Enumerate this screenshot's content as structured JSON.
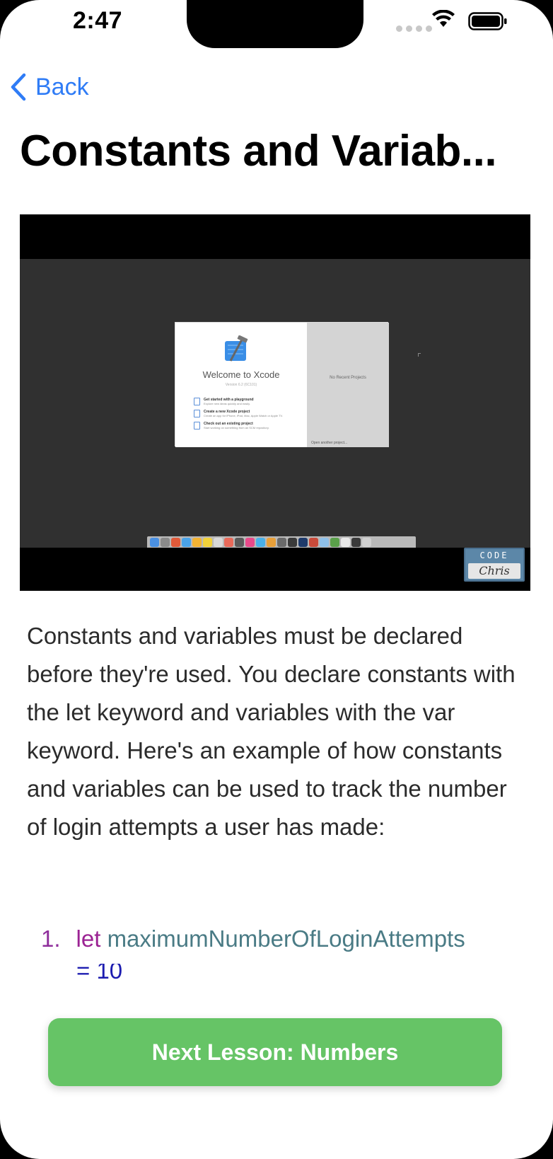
{
  "status_bar": {
    "time": "2:47"
  },
  "nav": {
    "back_label": "Back"
  },
  "lesson": {
    "title": "Constants and Variab...",
    "description": "Constants and variables must be declared before they're used. You declare constants with the let keyword and variables with the var keyword. Here's an example of how constants and variables can be used to track the number of login attempts a user has made:",
    "code": {
      "line_number": "1.",
      "keyword": "let",
      "identifier": "maximumNumberOfLoginAttempts",
      "continuation": "= 10"
    }
  },
  "video": {
    "xcode_welcome": "Welcome to Xcode",
    "xcode_version": "Version 6.2 (6C101)",
    "xcode_options": [
      {
        "title": "Get started with a playground",
        "subtitle": "Explore new ideas quickly and easily."
      },
      {
        "title": "Create a new Xcode project",
        "subtitle": "Create an app for iPhone, iPad, Mac, Apple Watch or Apple TV."
      },
      {
        "title": "Check out an existing project",
        "subtitle": "Start working on something from an SCM repository."
      }
    ],
    "xcode_no_recent": "No Recent Projects",
    "xcode_open_another": "Open another project...",
    "watermark_top": "CODE",
    "watermark_bottom": "Chris"
  },
  "next_button": {
    "label": "Next Lesson: Numbers"
  },
  "colors": {
    "accent": "#2f7cf6",
    "button_green": "#66c466",
    "code_keyword": "#9b2393",
    "code_identifier": "#4a7b85"
  },
  "icons": [
    "chevron-left-icon",
    "wifi-icon",
    "battery-icon",
    "xcode-hammer-icon"
  ]
}
